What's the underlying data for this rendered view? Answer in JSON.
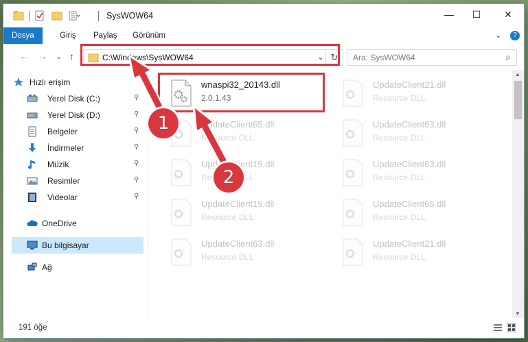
{
  "window": {
    "title": "SysWOW64",
    "minimize_glyph": "—",
    "maximize_glyph": "☐",
    "close_glyph": "✕"
  },
  "ribbon": {
    "tabs": [
      {
        "label": "Dosya",
        "active": true
      },
      {
        "label": "Giriş"
      },
      {
        "label": "Paylaş"
      },
      {
        "label": "Görünüm"
      }
    ],
    "expand_glyph": "⌄",
    "help_glyph": "?"
  },
  "navigation": {
    "back_glyph": "←",
    "forward_glyph": "→",
    "recent_glyph": "⌄",
    "up_glyph": "↑",
    "address": "C:\\Windows\\SysWOW64",
    "dropdown_glyph": "⌄",
    "refresh_glyph": "↻",
    "search_placeholder": "Ara: SysWOW64",
    "search_glyph": "⌕"
  },
  "sidebar": {
    "items": [
      {
        "label": "Hızlı erişim",
        "icon": "star-icon"
      },
      {
        "label": "Yerel Disk (C:)",
        "icon": "drive-icon",
        "pinned": true
      },
      {
        "label": "Yerel Disk (D:)",
        "icon": "drive-icon",
        "pinned": true
      },
      {
        "label": "Belgeler",
        "icon": "documents-icon",
        "pinned": true
      },
      {
        "label": "İndirmeler",
        "icon": "download-icon",
        "pinned": true
      },
      {
        "label": "Müzik",
        "icon": "music-icon",
        "pinned": true
      },
      {
        "label": "Resimler",
        "icon": "pictures-icon",
        "pinned": true
      },
      {
        "label": "Videolar",
        "icon": "videos-icon",
        "pinned": true
      },
      {
        "label": "OneDrive",
        "icon": "cloud-icon"
      },
      {
        "label": "Bu bilgisayar",
        "icon": "computer-icon",
        "selected": true
      },
      {
        "label": "Ağ",
        "icon": "network-icon"
      }
    ],
    "pin_glyph": "📌"
  },
  "files": [
    {
      "name": "wnaspi32_20143.dll",
      "type": "2.0.1.43",
      "highlighted": true
    },
    {
      "name": "UpdateClient21.dll",
      "type": "Resource DLL"
    },
    {
      "name": "UpdateClient65.dll",
      "type": "Resource DLL"
    },
    {
      "name": "UpdateClient63.dll",
      "type": "Resource DLL"
    },
    {
      "name": "UpdateClient19.dll",
      "type": "Resource DLL"
    },
    {
      "name": "UpdateClient63.dll",
      "type": "Resource DLL"
    },
    {
      "name": "UpdateClient19.dll",
      "type": "Resource DLL"
    },
    {
      "name": "UpdateClient65.dll",
      "type": "Resource DLL"
    },
    {
      "name": "UpdateClient63.dll",
      "type": "Resource DLL"
    },
    {
      "name": "UpdateClient21.dll",
      "type": "Resource DLL"
    }
  ],
  "status": {
    "item_count": "191 öğe"
  },
  "annotations": {
    "step1": "1",
    "step2": "2",
    "color": "#d9363e"
  }
}
